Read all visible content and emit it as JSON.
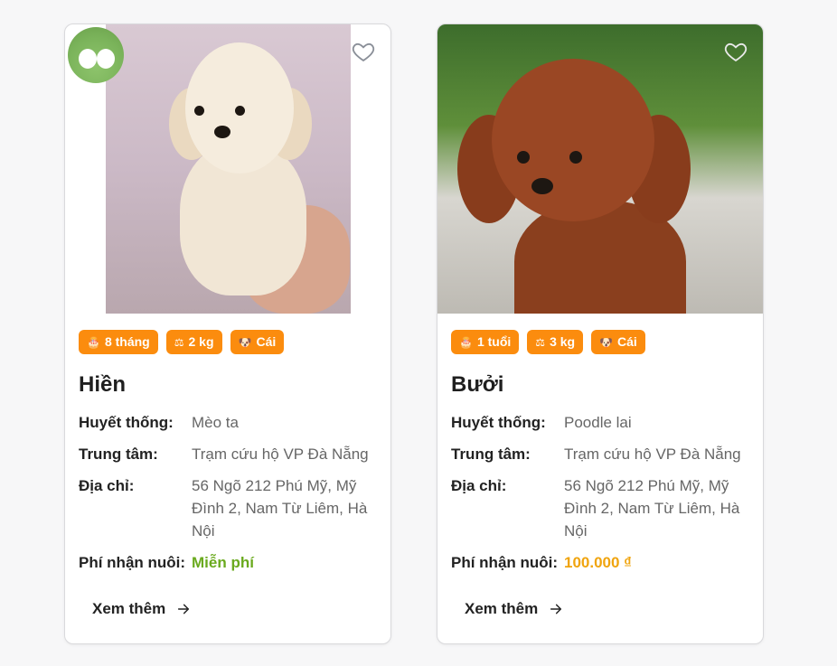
{
  "colors": {
    "tag_bg": "#fb8c0e",
    "fee_free": "#6aaa1e",
    "fee_paid": "#f0a40e"
  },
  "labels": {
    "breed": "Huyết thống:",
    "center": "Trung tâm:",
    "address": "Địa chỉ:",
    "fee": "Phí nhận nuôi:",
    "more": "Xem thêm"
  },
  "cards": [
    {
      "tags": {
        "age": "8 tháng",
        "weight": "2 kg",
        "gender": "Cái"
      },
      "name": "Hiền",
      "breed": "Mèo ta",
      "center": "Trạm cứu hộ VP Đà Nẵng",
      "address": "56 Ngõ 212 Phú Mỹ, Mỹ Đình 2, Nam Từ Liêm, Hà Nội",
      "fee": "Miễn phí"
    },
    {
      "tags": {
        "age": "1 tuổi",
        "weight": "3 kg",
        "gender": "Cái"
      },
      "name": "Bưởi",
      "breed": "Poodle lai",
      "center": "Trạm cứu hộ VP Đà Nẵng",
      "address": "56 Ngõ 212 Phú Mỹ, Mỹ Đình 2, Nam Từ Liêm, Hà Nội",
      "fee": "100.000 ₫"
    }
  ],
  "icons": {
    "favorite": "heart-outline-icon",
    "age": "cake-icon",
    "weight": "weight-icon",
    "gender": "paw-face-icon",
    "arrow": "arrow-right-icon"
  }
}
